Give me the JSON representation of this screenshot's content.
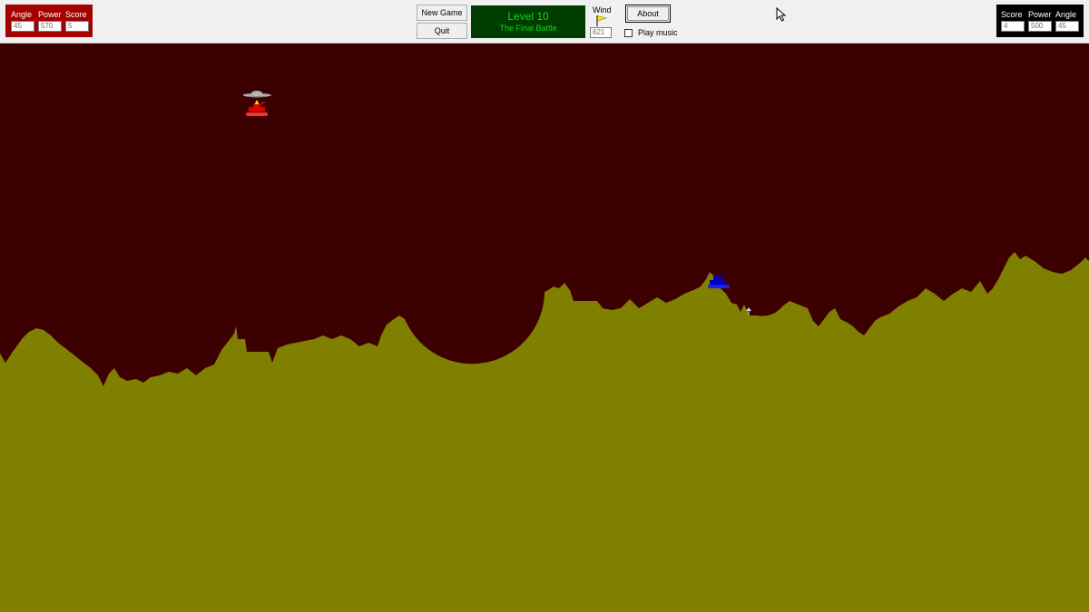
{
  "player1": {
    "angle_label": "Angle",
    "angle_value": "45",
    "power_label": "Power",
    "power_value": "570",
    "score_label": "Score",
    "score_value": "5",
    "color": "#a50000"
  },
  "player2": {
    "score_label": "Score",
    "score_value": "4",
    "power_label": "Power",
    "power_value": "500",
    "angle_label": "Angle",
    "angle_value": "45",
    "color": "#000000"
  },
  "controls": {
    "new_game_label": "New Game",
    "quit_label": "Quit",
    "about_label": "About",
    "wind_label": "Wind",
    "wind_value": "621",
    "music_label": "Play music",
    "music_checked": false
  },
  "level": {
    "title": "Level 10",
    "subtitle": "The Final Battle"
  },
  "scene": {
    "sky_color": "#3c0000",
    "ground_color": "#808000",
    "player1_tank_color": "#e00000",
    "player2_tank_color": "#0000c8",
    "wind_flag_color": "#ffe600"
  }
}
